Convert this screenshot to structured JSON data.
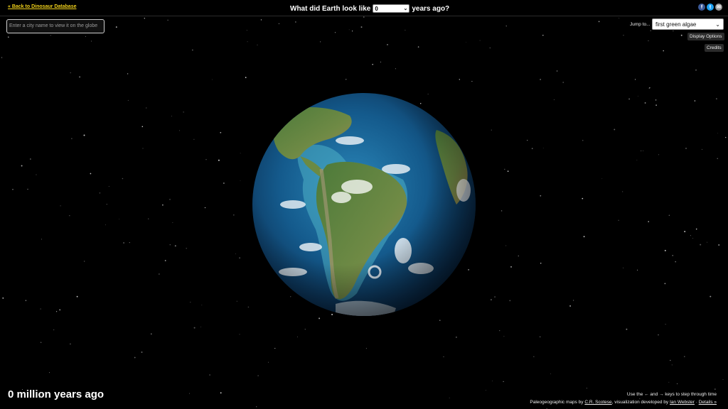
{
  "header": {
    "back_link": "« Back to Dinosaur Database",
    "question_prefix": "What did Earth look like",
    "year_value": "0",
    "question_suffix": "years ago?"
  },
  "social": {
    "facebook_glyph": "f",
    "twitter_glyph": "t",
    "email_glyph": "✉"
  },
  "search": {
    "placeholder": "Enter a city name to view it on the globe"
  },
  "jump": {
    "label": "Jump to...",
    "selected": "first green algae"
  },
  "buttons": {
    "display_options": "Display Options",
    "credits": "Credits"
  },
  "status": {
    "age_text": "0 million years ago"
  },
  "footer": {
    "hint": "Use the ← and → keys to step through time",
    "maps_prefix": "Paleogeographic maps by",
    "maps_author": "C.R. Scotese",
    "viz_prefix": ", visualization developed by",
    "viz_author": "Ian Webster",
    "separator": " · ",
    "details": "Details »"
  },
  "colors": {
    "link_yellow": "#f2d21b",
    "facebook": "#3b5998",
    "twitter": "#1da1f2",
    "email": "#9a9a9a"
  }
}
